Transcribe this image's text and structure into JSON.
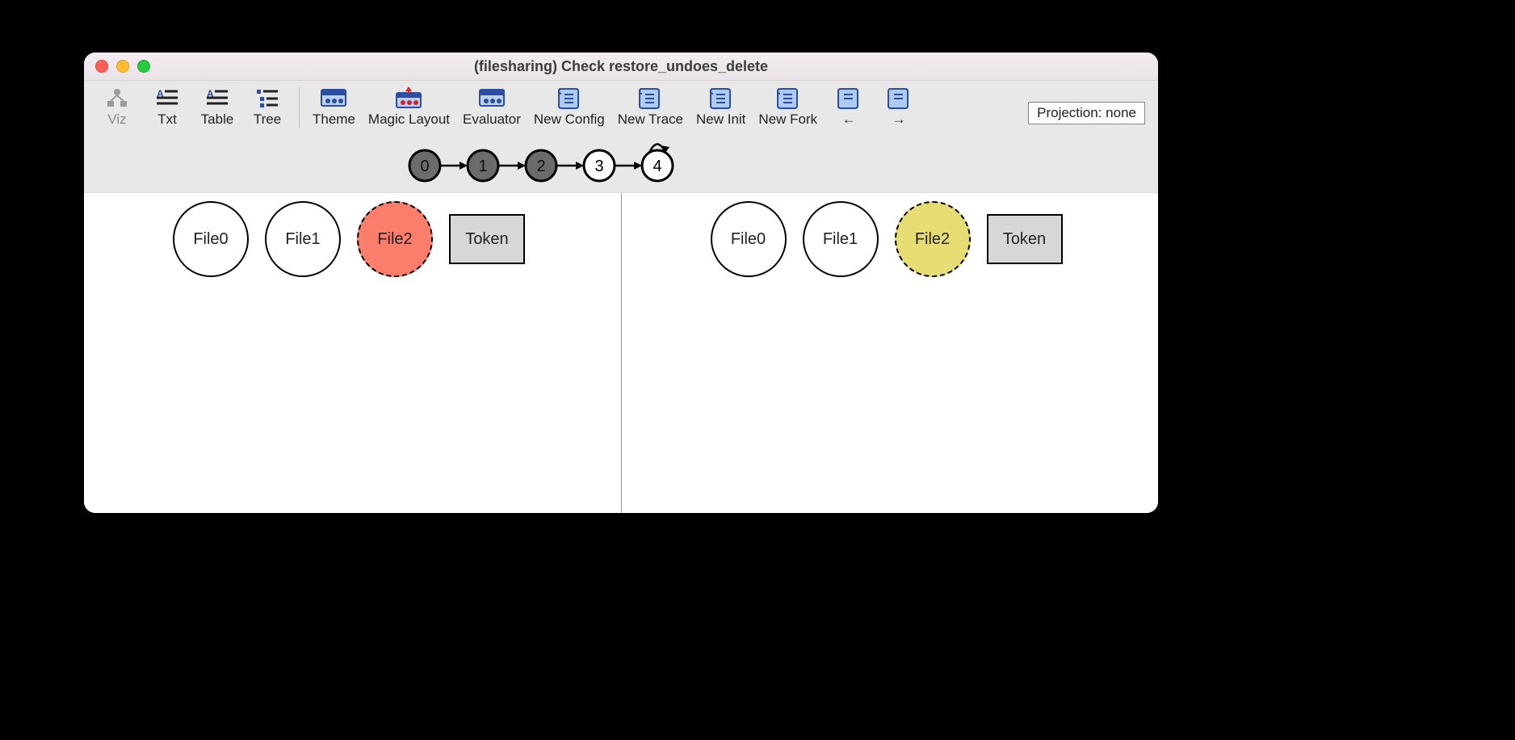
{
  "title": "(filesharing) Check restore_undoes_delete",
  "toolbar": {
    "viz": "Viz",
    "txt": "Txt",
    "table": "Table",
    "tree": "Tree",
    "theme": "Theme",
    "magic": "Magic Layout",
    "eval": "Evaluator",
    "newconfig": "New Config",
    "newtrace": "New Trace",
    "newinit": "New Init",
    "newfork": "New Fork",
    "left": "←",
    "right": "→"
  },
  "projection_label": "Projection: none",
  "trace": {
    "states": [
      "0",
      "1",
      "2",
      "3",
      "4"
    ],
    "filled": [
      true,
      true,
      true,
      false,
      false
    ],
    "selfloop_on": 4
  },
  "left_pane": {
    "nodes": [
      {
        "label": "File0",
        "shape": "circle",
        "style": "solid",
        "fill": "white"
      },
      {
        "label": "File1",
        "shape": "circle",
        "style": "solid",
        "fill": "white"
      },
      {
        "label": "File2",
        "shape": "circle",
        "style": "dashed",
        "fill": "red"
      },
      {
        "label": "Token",
        "shape": "box",
        "style": "solid",
        "fill": "grey"
      }
    ]
  },
  "right_pane": {
    "nodes": [
      {
        "label": "File0",
        "shape": "circle",
        "style": "solid",
        "fill": "white"
      },
      {
        "label": "File1",
        "shape": "circle",
        "style": "solid",
        "fill": "white"
      },
      {
        "label": "File2",
        "shape": "circle",
        "style": "dashed",
        "fill": "yellow"
      },
      {
        "label": "Token",
        "shape": "box",
        "style": "solid",
        "fill": "grey"
      }
    ]
  }
}
